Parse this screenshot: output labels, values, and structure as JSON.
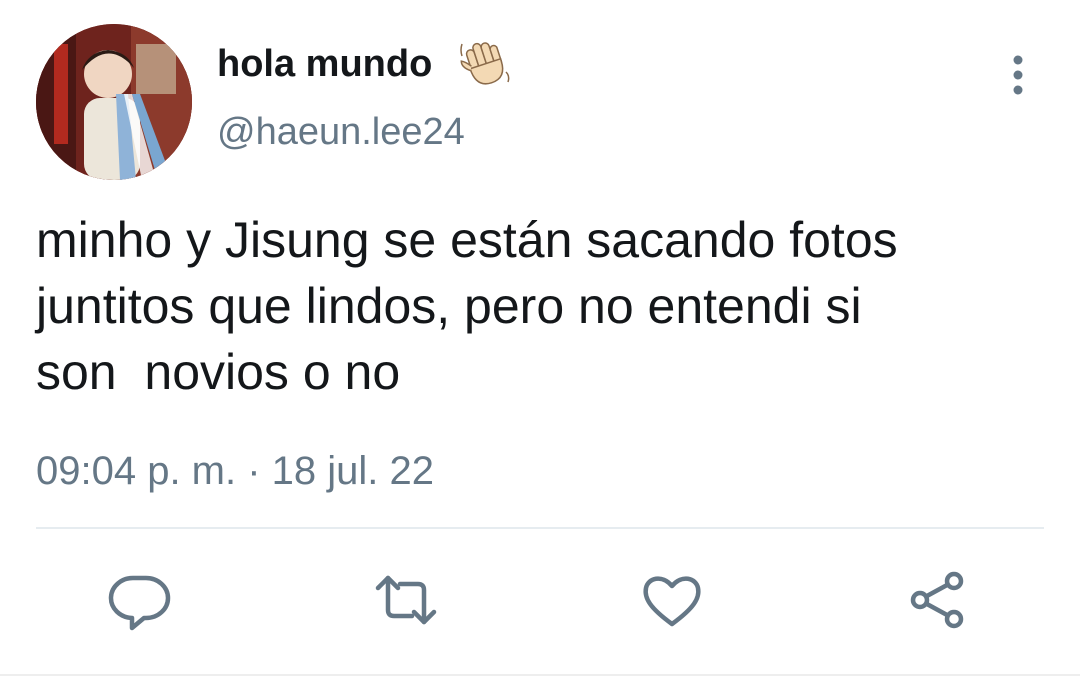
{
  "user": {
    "display_name": "hola mundo",
    "name_emoji": "waving-hand-icon",
    "handle": "@haeun.lee24"
  },
  "tweet": {
    "text": "minho y Jisung se están sacando fotos\njuntitos que lindos, pero no entendi si\nson  novios o no",
    "timestamp": "09:04 p. m. · 18 jul. 22"
  },
  "actions": [
    {
      "name": "reply",
      "icon": "reply-icon"
    },
    {
      "name": "retweet",
      "icon": "retweet-icon"
    },
    {
      "name": "like",
      "icon": "heart-icon"
    },
    {
      "name": "share",
      "icon": "share-icon"
    }
  ],
  "colors": {
    "text": "#14171a",
    "secondary": "#657786",
    "divider": "#e6ecf0"
  }
}
